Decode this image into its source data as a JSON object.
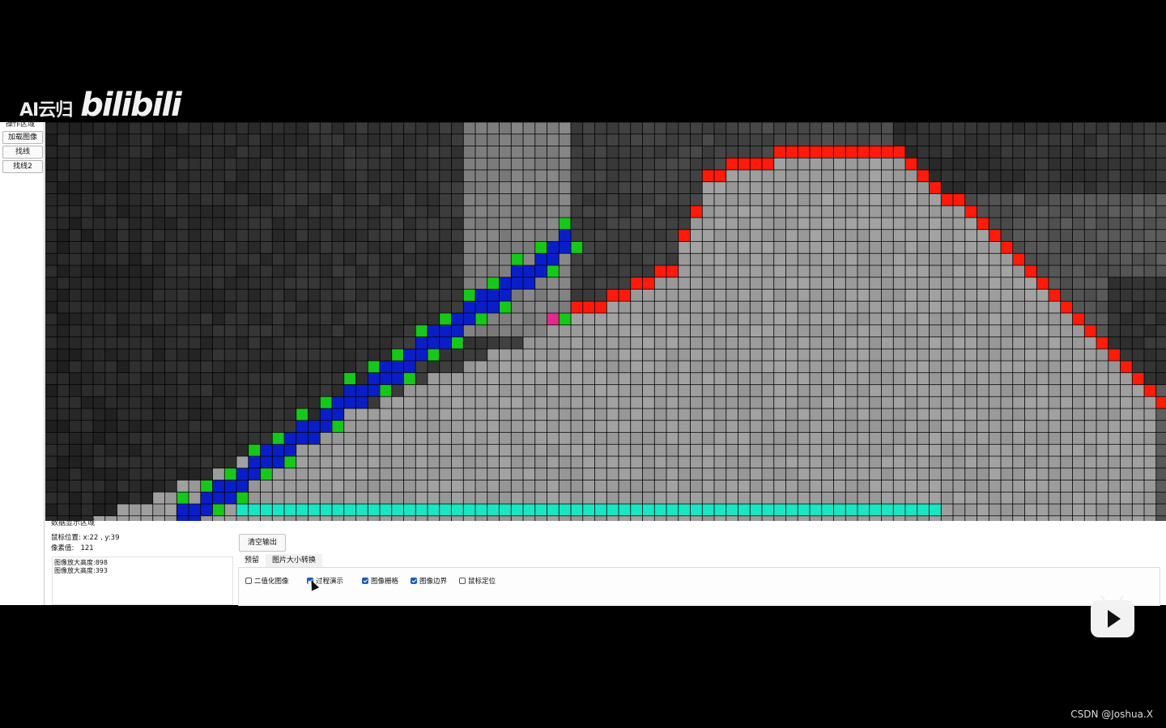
{
  "watermark": {
    "text": "AI云归",
    "logo": "bilibili"
  },
  "ops_panel": {
    "title": "操作区域",
    "buttons": [
      "加载图像",
      "找线",
      "找线2"
    ]
  },
  "data_area": {
    "title": "数据显示区域",
    "mouse_position": "鼠标位置: x:22 , y:39",
    "pixel_value": "像素值:   121",
    "output_lines": [
      "图像放大高度:898",
      "图像放大高度:393"
    ],
    "clear_button": "清空输出"
  },
  "tabs": {
    "active": "预留",
    "other": "图片大小转换"
  },
  "checkboxes": [
    {
      "label": "二值化图像",
      "checked": false
    },
    {
      "label": "过程演示",
      "checked": true
    },
    {
      "label": "图像栅格",
      "checked": true
    },
    {
      "label": "图像边界",
      "checked": true
    },
    {
      "label": "鼠标定位",
      "checked": false
    }
  ],
  "colors": {
    "boundary_red": "#ff1a0a",
    "search_blue": "#0a1ec8",
    "search_green": "#16c81a",
    "baseline_cyan": "#19e6c3",
    "current_magenta": "#e6288c",
    "grid_line": "#000000"
  },
  "credit": "CSDN @Joshua.X"
}
